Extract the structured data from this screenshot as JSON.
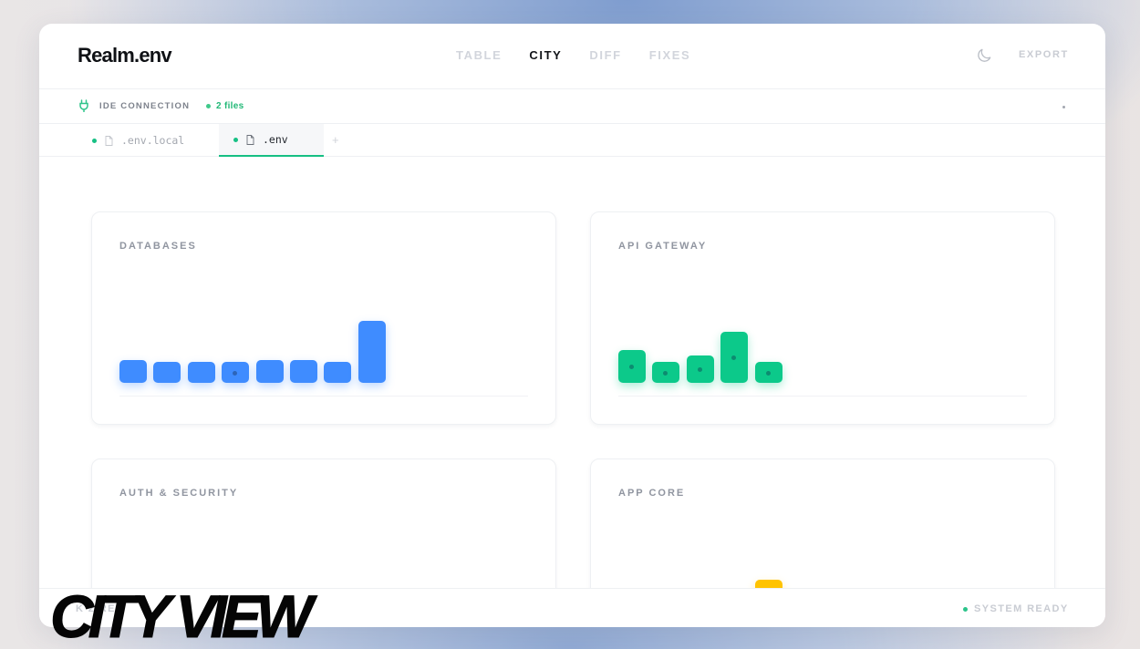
{
  "app": {
    "brand": "Realm.env"
  },
  "nav": {
    "tabs": [
      {
        "label": "TABLE",
        "active": false
      },
      {
        "label": "CITY",
        "active": true
      },
      {
        "label": "DIFF",
        "active": false
      },
      {
        "label": "FIXES",
        "active": false
      }
    ],
    "theme_icon": "moon-icon",
    "export_label": "EXPORT"
  },
  "ide": {
    "label": "IDE CONNECTION",
    "files": "2 files",
    "icon": "plug-icon"
  },
  "file_tabs": [
    {
      "name": ".env.local",
      "active": false
    },
    {
      "name": ".env",
      "active": true
    }
  ],
  "add_tab": "+",
  "districts": [
    {
      "title": "DATABASES",
      "color": "#3f8cff",
      "buildings": [
        1,
        0.9,
        0.9,
        0.9,
        1,
        1,
        0.9,
        2.7
      ],
      "lit_windows": [
        3
      ]
    },
    {
      "title": "API GATEWAY",
      "color": "#0cc98a",
      "buildings": [
        1.45,
        0.9,
        1.2,
        2.25,
        0.9
      ],
      "lit_windows": [
        0,
        1,
        2,
        3,
        4
      ]
    },
    {
      "title": "AUTH & SECURITY",
      "color": "#3f8cff",
      "buildings": [],
      "lit_windows": []
    },
    {
      "title": "APP CORE",
      "color": "#ffc300",
      "buildings": [
        0,
        0,
        0,
        0,
        2.2
      ],
      "lit_windows": []
    }
  ],
  "footer": {
    "status": "SYSTEM READY",
    "left_text": "K 2 RE"
  },
  "overlay": {
    "title": "CITY VIEW"
  }
}
